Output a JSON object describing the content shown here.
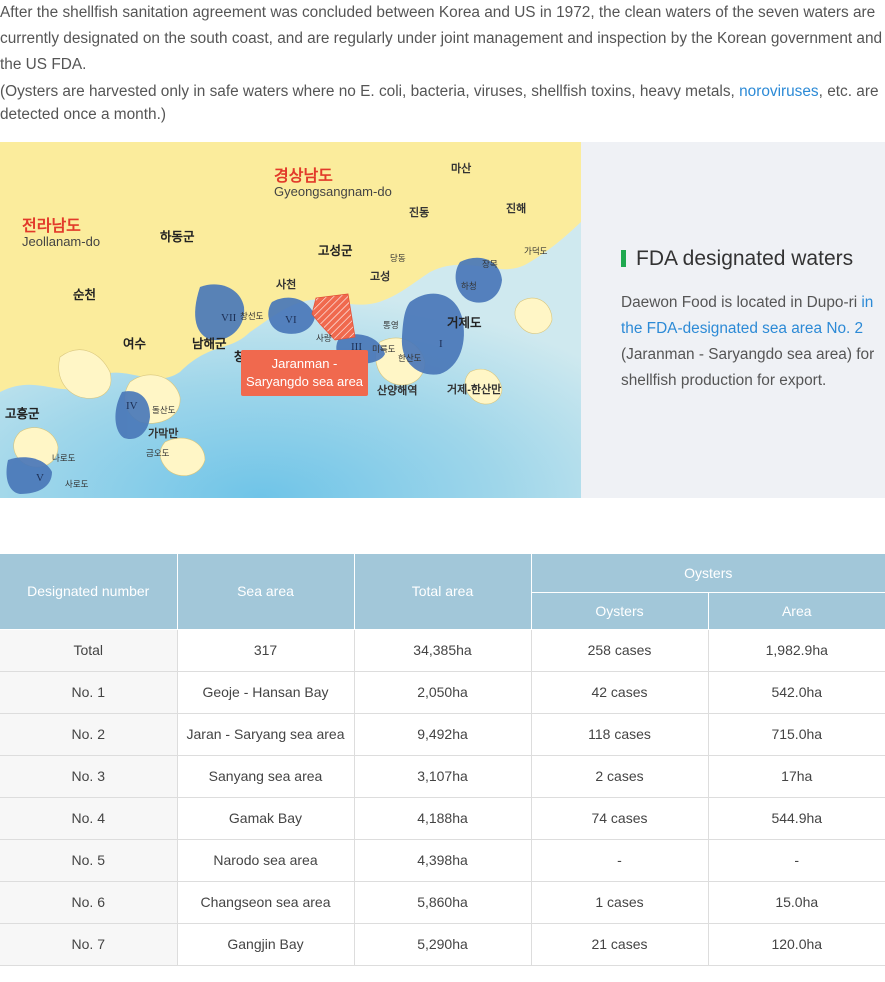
{
  "intro": {
    "paragraph": "After the shellfish sanitation agreement was concluded between Korea and US in 1972, the clean waters of the seven waters are currently designated on the south coast, and are regularly under joint management and inspection by the Korean government and the US FDA.",
    "note_before": "(Oysters are harvested only in safe waters where no E. coli, bacteria, viruses, shellfish toxins, heavy metals, ",
    "note_link": "noroviruses",
    "note_after": ", etc. are detected once a month.)"
  },
  "map": {
    "regions": {
      "gyeongsang_ko": "경상남도",
      "gyeongsang_en": "Gyeongsangnam-do",
      "jeolla_ko": "전라남도",
      "jeolla_en": "Jeollanam-do"
    },
    "cities": {
      "hadong": "하동군",
      "goseong_gun": "고성군",
      "suncheon": "순천",
      "namhae": "남해군",
      "yeosu": "여수",
      "geoje": "거제도",
      "goheung": "고흥군",
      "sacheon": "사천",
      "masan": "마산",
      "jinhae": "진해",
      "jindong": "진동",
      "dangdong": "당동",
      "goseong": "고성",
      "gadeokdo": "가덕도",
      "jangmok": "장목",
      "hacheong": "하청",
      "tongyeong": "통영",
      "mireukdo": "미륵도",
      "hansando": "한산도",
      "sanyang": "산양해역",
      "geoje_hansan": "거제-한산만",
      "changseondo": "창선도",
      "dolsando": "돌산도",
      "gamakman": "가막만",
      "geumodo": "금오도",
      "narodo": "나로도",
      "sarodo": "사로도",
      "jang": "창",
      "saryang": "사량"
    },
    "roman": [
      "I",
      "III",
      "IV",
      "V",
      "VI",
      "VII"
    ],
    "callout": [
      "Jaranman -",
      "Saryangdo sea area"
    ]
  },
  "fda": {
    "title": "FDA designated waters",
    "desc_before": "Daewon Food is located in Dupo-ri ",
    "desc_link": "in the FDA-designated sea area No. 2",
    "desc_after": " (Jaranman - Saryangdo sea area) for shellfish production for export."
  },
  "table": {
    "headers": {
      "designated_number": "Designated number",
      "sea_area": "Sea area",
      "total_area": "Total area",
      "oysters_group": "Oysters",
      "oysters": "Oysters",
      "area": "Area"
    },
    "rows": [
      [
        "Total",
        "317",
        "34,385ha",
        "258 cases",
        "1,982.9ha"
      ],
      [
        "No. 1",
        "Geoje - Hansan Bay",
        "2,050ha",
        "42 cases",
        "542.0ha"
      ],
      [
        "No. 2",
        "Jaran - Saryang sea area",
        "9,492ha",
        "118 cases",
        "715.0ha"
      ],
      [
        "No. 3",
        "Sanyang sea area",
        "3,107ha",
        "2 cases",
        "17ha"
      ],
      [
        "No. 4",
        "Gamak Bay",
        "4,188ha",
        "74 cases",
        "544.9ha"
      ],
      [
        "No. 5",
        "Narodo sea area",
        "4,398ha",
        "-",
        "-"
      ],
      [
        "No. 6",
        "Changseon sea area",
        "5,860ha",
        "1 cases",
        "15.0ha"
      ],
      [
        "No. 7",
        "Gangjin Bay",
        "5,290ha",
        "21 cases",
        "120.0ha"
      ]
    ]
  },
  "colors": {
    "link": "#2c8ad6",
    "accent_green": "#1fa84f",
    "table_header": "#a2c7d9",
    "callout": "#f0694e",
    "land": "#fbec9c",
    "sea": "#9fd6ea"
  }
}
